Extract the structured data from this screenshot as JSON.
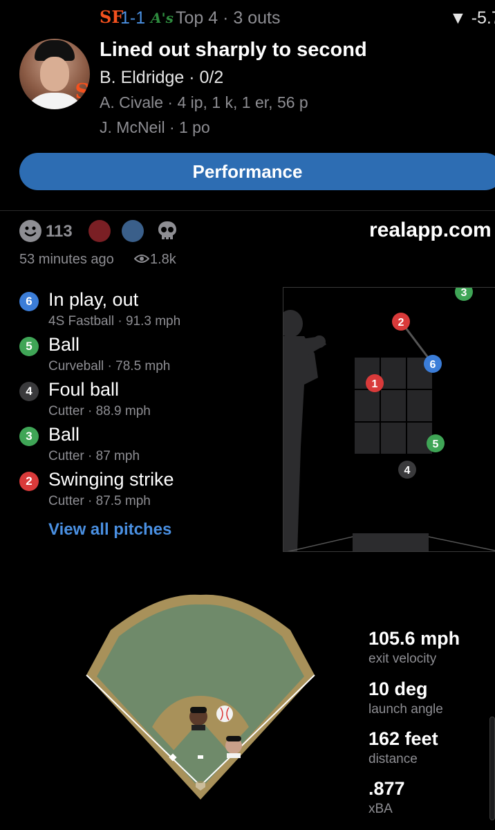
{
  "header": {
    "home_logo": "SF",
    "score": "1-1",
    "away_logo": "A's",
    "inning": "Top 4 · 3 outs",
    "win_prob": "▼ -5.7"
  },
  "play": {
    "headline": "Lined out sharply to second",
    "batter": "B. Eldridge · 0/2",
    "pitcher": "A. Civale · 4 ip, 1 k, 1 er, 56 p",
    "fielder": "J. McNeil · 1 po"
  },
  "performance_button": "Performance",
  "reactions": {
    "count": "113",
    "site": "realapp.com",
    "time_ago": "53 minutes ago",
    "views": "1.8k"
  },
  "colors": {
    "blue": "#3B7DD8",
    "green": "#3FA556",
    "gray": "#3a3a3c",
    "red": "#D93A3A"
  },
  "pitches": [
    {
      "num": "6",
      "result": "In play, out",
      "type": "4S Fastball",
      "speed": "91.3 mph",
      "color": "#3B7DD8"
    },
    {
      "num": "5",
      "result": "Ball",
      "type": "Curveball",
      "speed": "78.5 mph",
      "color": "#3FA556"
    },
    {
      "num": "4",
      "result": "Foul ball",
      "type": "Cutter",
      "speed": "88.9 mph",
      "color": "#3a3a3c"
    },
    {
      "num": "3",
      "result": "Ball",
      "type": "Cutter",
      "speed": "87 mph",
      "color": "#3FA556"
    },
    {
      "num": "2",
      "result": "Swinging strike",
      "type": "Cutter",
      "speed": "87.5 mph",
      "color": "#D93A3A"
    }
  ],
  "zone_marks": [
    {
      "num": "1",
      "color": "#D93A3A"
    },
    {
      "num": "2",
      "color": "#D93A3A"
    },
    {
      "num": "3",
      "color": "#3FA556"
    },
    {
      "num": "4",
      "color": "#3a3a3c"
    },
    {
      "num": "5",
      "color": "#3FA556"
    },
    {
      "num": "6",
      "color": "#3B7DD8"
    }
  ],
  "view_all": "View all pitches",
  "stats": [
    {
      "value": "105.6 mph",
      "label": "exit velocity"
    },
    {
      "value": "10 deg",
      "label": "launch angle"
    },
    {
      "value": "162 feet",
      "label": "distance"
    },
    {
      "value": ".877",
      "label": "xBA"
    }
  ]
}
